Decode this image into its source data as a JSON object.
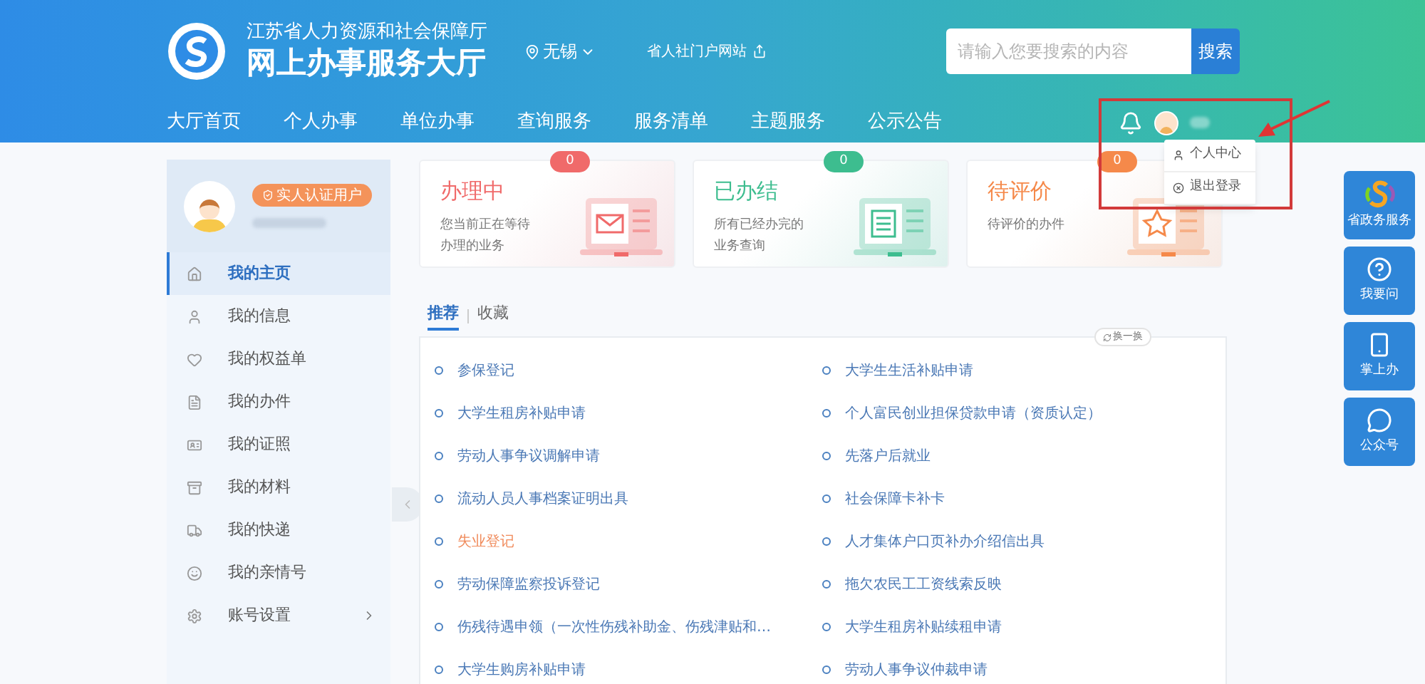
{
  "header": {
    "org_name": "江苏省人力资源和社会保障厅",
    "title": "网上办事服务大厅",
    "city": "无锡",
    "portal_link": "省人社门户网站",
    "search": {
      "placeholder": "请输入您要搜索的内容",
      "button": "搜索"
    }
  },
  "nav": [
    {
      "label": "大厅首页"
    },
    {
      "label": "个人办事"
    },
    {
      "label": "单位办事"
    },
    {
      "label": "查询服务"
    },
    {
      "label": "服务清单"
    },
    {
      "label": "主题服务"
    },
    {
      "label": "公示公告"
    }
  ],
  "user_menu": [
    {
      "label": "个人中心"
    },
    {
      "label": "退出登录"
    }
  ],
  "profile": {
    "badge": "实人认证用户"
  },
  "sidebar": [
    {
      "label": "我的主页",
      "selected": true,
      "has_submenu": false
    },
    {
      "label": "我的信息",
      "selected": false,
      "has_submenu": false
    },
    {
      "label": "我的权益单",
      "selected": false,
      "has_submenu": false
    },
    {
      "label": "我的办件",
      "selected": false,
      "has_submenu": false
    },
    {
      "label": "我的证照",
      "selected": false,
      "has_submenu": false
    },
    {
      "label": "我的材料",
      "selected": false,
      "has_submenu": false
    },
    {
      "label": "我的快递",
      "selected": false,
      "has_submenu": false
    },
    {
      "label": "我的亲情号",
      "selected": false,
      "has_submenu": false
    },
    {
      "label": "账号设置",
      "selected": false,
      "has_submenu": true
    }
  ],
  "cards": [
    {
      "title": "办理中",
      "description": [
        "您当前正在等待",
        "办理的业务"
      ],
      "count": "0",
      "color": "#f06a6a"
    },
    {
      "title": "已办结",
      "description": [
        "所有已经办完的",
        "业务查询"
      ],
      "count": "0",
      "color": "#3dbd8f"
    },
    {
      "title": "待评价",
      "description": [
        "待评价的办件"
      ],
      "count": "0",
      "color": "#f5894a"
    }
  ],
  "tabs": [
    {
      "label": "推荐",
      "selected": true
    },
    {
      "label": "收藏",
      "selected": false
    }
  ],
  "refresh": "换一换",
  "services": [
    {
      "label": "参保登记",
      "highlighted": false
    },
    {
      "label": "大学生生活补贴申请",
      "highlighted": false
    },
    {
      "label": "大学生租房补贴申请",
      "highlighted": false
    },
    {
      "label": "个人富民创业担保贷款申请（资质认定）",
      "highlighted": false
    },
    {
      "label": "劳动人事争议调解申请",
      "highlighted": false
    },
    {
      "label": "先落户后就业",
      "highlighted": false
    },
    {
      "label": "流动人员人事档案证明出具",
      "highlighted": false
    },
    {
      "label": "社会保障卡补卡",
      "highlighted": false
    },
    {
      "label": "失业登记",
      "highlighted": true
    },
    {
      "label": "人才集体户口页补办介绍信出具",
      "highlighted": false
    },
    {
      "label": "劳动保障监察投诉登记",
      "highlighted": false
    },
    {
      "label": "拖欠农民工工资线索反映",
      "highlighted": false
    },
    {
      "label": "伤残待遇申领（一次性伤残补助金、伤残津贴和…",
      "highlighted": false
    },
    {
      "label": "大学生租房补贴续租申请",
      "highlighted": false
    },
    {
      "label": "大学生购房补贴申请",
      "highlighted": false
    },
    {
      "label": "劳动人事争议仲裁申请",
      "highlighted": false
    }
  ],
  "side_buttons": [
    {
      "label": "省政务服务"
    },
    {
      "label": "我要问"
    },
    {
      "label": "掌上办"
    },
    {
      "label": "公众号"
    }
  ]
}
